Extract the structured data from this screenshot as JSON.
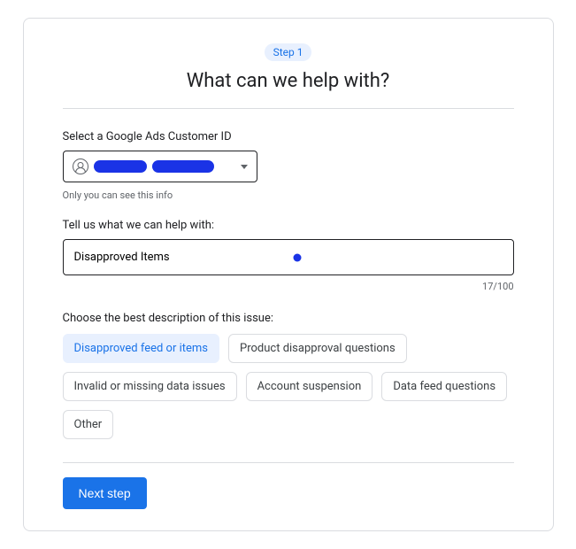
{
  "step_badge": "Step 1",
  "title": "What can we help with?",
  "customer_id": {
    "label": "Select a Google Ads Customer ID",
    "hint": "Only you can see this info"
  },
  "help_with": {
    "label": "Tell us what we can help with:",
    "value": "Disapproved Items",
    "counter": "17/100"
  },
  "description": {
    "label": "Choose the best description of this issue:",
    "chips": [
      {
        "label": "Disapproved feed or items",
        "selected": true
      },
      {
        "label": "Product disapproval questions",
        "selected": false
      },
      {
        "label": "Invalid or missing data issues",
        "selected": false
      },
      {
        "label": "Account suspension",
        "selected": false
      },
      {
        "label": "Data feed questions",
        "selected": false
      },
      {
        "label": "Other",
        "selected": false
      }
    ]
  },
  "next_button": "Next step"
}
